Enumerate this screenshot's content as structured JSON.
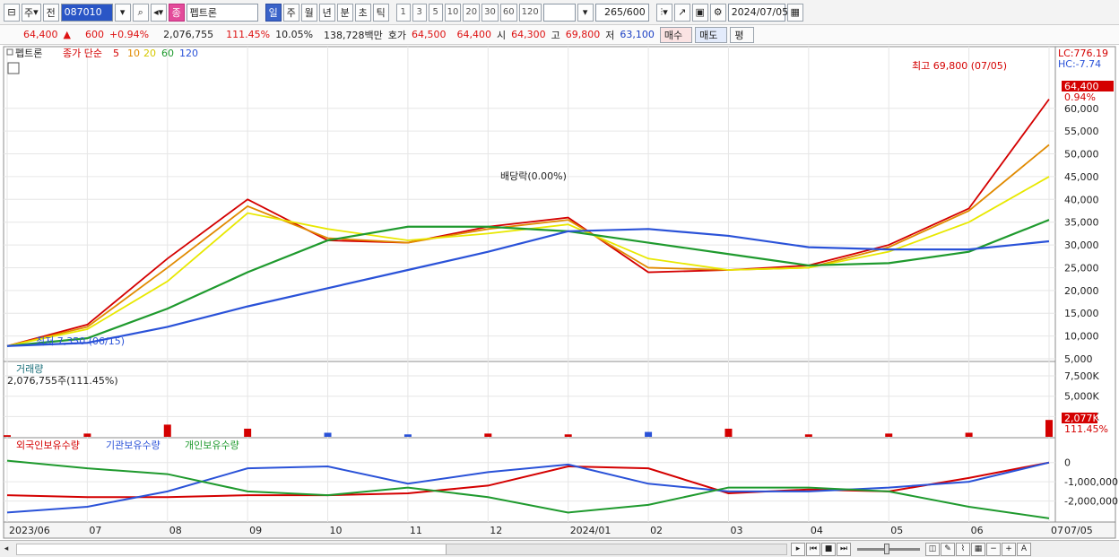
{
  "toolbar": {
    "period_label": "주",
    "prev_label": "전",
    "stock_code": "087010",
    "stock_name": "펩트론",
    "name_badge": "종",
    "periods": [
      "일",
      "주",
      "월",
      "년",
      "분",
      "초",
      "틱"
    ],
    "active_period": "일",
    "intervals": [
      "1",
      "3",
      "5",
      "10",
      "20",
      "30",
      "60",
      "120"
    ],
    "count_value": "265",
    "count_total": "/600",
    "date_value": "2024/07/05"
  },
  "quote": {
    "price": "64,400",
    "change_arrow": "▲",
    "change": "600",
    "change_pct": "+0.94%",
    "volume": "2,076,755",
    "volume_ratio": "111.45%",
    "turnover": "10.05%",
    "amount": "138,728백만",
    "bid_label": "호가",
    "bid1": "64,500",
    "bid2": "64,400",
    "open_label": "시",
    "open": "64,300",
    "high_label": "고",
    "high": "69,800",
    "low_label": "저",
    "low": "63,100",
    "buy_label": "매수",
    "sell_label": "매도",
    "extra_label": "평"
  },
  "price_panel": {
    "title": "펩트론",
    "ma_label": "종가 단순",
    "ma_periods": [
      "5",
      "10",
      "20",
      "60",
      "120"
    ],
    "ma_colors": [
      "#d40000",
      "#e08a00",
      "#e8e800",
      "#1f9a2e",
      "#2a52d8"
    ],
    "lc_label": "LC:776.19",
    "hc_label": "HC:-7.74",
    "price_tag": "64,400",
    "pct_tag": "0.94%",
    "high_annotation": "최고 69,800 (07/05)",
    "low_annotation": "최저 7,350 (06/15)",
    "dividend_annotation": "배당락(0.00%)",
    "y_ticks": [
      "60,000",
      "55,000",
      "50,000",
      "45,000",
      "40,000",
      "35,000",
      "30,000",
      "25,000",
      "20,000",
      "15,000",
      "10,000",
      "5,000"
    ]
  },
  "volume_panel": {
    "title": "거래량",
    "value_label": "2,076,755주(111.45%)",
    "y_ticks": [
      "7,500K",
      "5,000K",
      "2,500K"
    ],
    "tag_value": "2,077K",
    "tag_pct": "111.45%"
  },
  "holding_panel": {
    "series": [
      {
        "label": "외국인보유수량",
        "color": "#d40000"
      },
      {
        "label": "기관보유수량",
        "color": "#2a52d8"
      },
      {
        "label": "개인보유수량",
        "color": "#1f9a2e"
      }
    ],
    "y_ticks": [
      "0",
      "-1,000,000",
      "-2,000,000"
    ]
  },
  "x_axis": {
    "labels": [
      "2023/06",
      "07",
      "08",
      "09",
      "10",
      "11",
      "12",
      "2024/01",
      "02",
      "03",
      "04",
      "05",
      "06",
      "07"
    ],
    "right_label": "07/05"
  },
  "chart_data": {
    "type": "line",
    "x": [
      "2023/06",
      "07",
      "08",
      "09",
      "10",
      "11",
      "12",
      "2024/01",
      "02",
      "03",
      "04",
      "05",
      "06",
      "07"
    ],
    "series": [
      {
        "name": "5",
        "values": [
          7800,
          12500,
          27000,
          40000,
          31000,
          30500,
          34000,
          36000,
          24000,
          24500,
          25500,
          30000,
          38000,
          62000
        ]
      },
      {
        "name": "10",
        "values": [
          7800,
          12000,
          25000,
          38500,
          31500,
          30500,
          33500,
          35500,
          25000,
          24500,
          25000,
          29500,
          37500,
          52000
        ]
      },
      {
        "name": "20",
        "values": [
          7800,
          11500,
          22000,
          37000,
          33500,
          31000,
          32500,
          34500,
          27000,
          24500,
          25000,
          28500,
          35000,
          45000
        ]
      },
      {
        "name": "60",
        "values": [
          7800,
          9500,
          16000,
          24000,
          31000,
          34000,
          34000,
          33000,
          30500,
          28000,
          25500,
          26000,
          28500,
          35500
        ]
      },
      {
        "name": "120",
        "values": [
          7800,
          8500,
          12000,
          16500,
          20500,
          24500,
          28500,
          33000,
          33500,
          32000,
          29500,
          29000,
          29000,
          30800
        ]
      }
    ],
    "volume_k": [
      200,
      400,
      1500,
      1000,
      500,
      300,
      400,
      300,
      600,
      1000,
      300,
      400,
      500,
      2077
    ],
    "ylim": [
      5000,
      70000
    ],
    "volume_ylim": [
      0,
      8500
    ],
    "holdings": {
      "foreign": [
        -1700000,
        -1800000,
        -1800000,
        -1700000,
        -1700000,
        -1600000,
        -1200000,
        -200000,
        -300000,
        -1600000,
        -1400000,
        -1500000,
        -800000,
        0
      ],
      "institution": [
        -2600000,
        -2300000,
        -1500000,
        -300000,
        -200000,
        -1100000,
        -500000,
        -100000,
        -1100000,
        -1500000,
        -1500000,
        -1300000,
        -1000000,
        0
      ],
      "individual": [
        100000,
        -300000,
        -600000,
        -1500000,
        -1700000,
        -1300000,
        -1800000,
        -2600000,
        -2200000,
        -1300000,
        -1300000,
        -1500000,
        -2300000,
        -2900000
      ]
    },
    "holdings_ylim": [
      -3000000,
      500000
    ]
  }
}
